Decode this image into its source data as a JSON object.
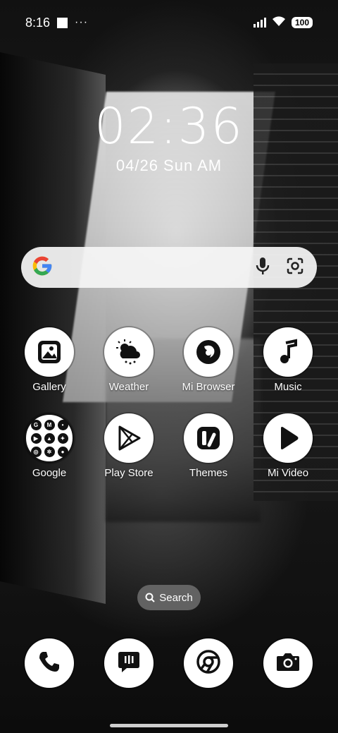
{
  "status_bar": {
    "time": "8:16",
    "dots": "···",
    "battery": "100"
  },
  "clock": {
    "time": "02:36",
    "date": "04/26 Sun AM"
  },
  "search_widget": {
    "icons": [
      "google-g-icon",
      "microphone-icon",
      "google-lens-icon"
    ]
  },
  "apps": [
    {
      "label": "Gallery",
      "icon": "gallery-icon"
    },
    {
      "label": "Weather",
      "icon": "weather-icon"
    },
    {
      "label": "Mi Browser",
      "icon": "browser-icon"
    },
    {
      "label": "Music",
      "icon": "music-note-icon"
    },
    {
      "label": "Google",
      "icon": "folder-icon"
    },
    {
      "label": "Play Store",
      "icon": "play-store-icon"
    },
    {
      "label": "Themes",
      "icon": "themes-icon"
    },
    {
      "label": "Mi Video",
      "icon": "video-play-icon"
    }
  ],
  "search_pill": {
    "label": "Search"
  },
  "dock": [
    {
      "icon": "phone-icon"
    },
    {
      "icon": "messages-icon"
    },
    {
      "icon": "chrome-icon"
    },
    {
      "icon": "camera-icon"
    }
  ],
  "colors": {
    "icon_bg": "#ffffff",
    "icon_fg": "#111111",
    "google_blue": "#4285F4",
    "google_red": "#EA4335",
    "google_yellow": "#FBBC05",
    "google_green": "#34A853"
  }
}
